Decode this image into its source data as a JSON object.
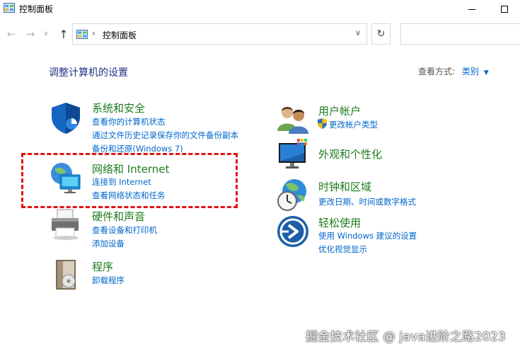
{
  "window": {
    "title": "控制面板"
  },
  "address": {
    "path": "控制面板"
  },
  "header": {
    "heading": "调整计算机的设置",
    "view_by_label": "查看方式:",
    "view_by_value": "类别"
  },
  "categories": [
    {
      "title": "系统和安全",
      "icon": "shield-icon",
      "links": [
        "查看你的计算机状态",
        "通过文件历史记录保存你的文件备份副本",
        "备份和还原(Windows 7)"
      ]
    },
    {
      "title": "网络和 Internet",
      "icon": "network-globe-icon",
      "links": [
        "连接到 Internet",
        "查看网络状态和任务"
      ]
    },
    {
      "title": "硬件和声音",
      "icon": "printer-icon",
      "links": [
        "查看设备和打印机",
        "添加设备"
      ]
    },
    {
      "title": "程序",
      "icon": "programs-disk-icon",
      "links": [
        "卸载程序"
      ]
    },
    {
      "title": "用户帐户",
      "icon": "users-icon",
      "links": [
        "更改帐户类型"
      ]
    },
    {
      "title": "外观和个性化",
      "icon": "monitor-palette-icon",
      "links": []
    },
    {
      "title": "时钟和区域",
      "icon": "globe-clock-icon",
      "links": [
        "更改日期、时间或数字格式"
      ]
    },
    {
      "title": "轻松使用",
      "icon": "accessibility-icon",
      "links": [
        "使用 Windows 建议的设置",
        "优化视觉显示"
      ]
    }
  ],
  "watermark": "掘金技术社区 @ java进阶之路2023",
  "colors": {
    "category_title": "#1d7b1d",
    "link": "#0066cc",
    "heading": "#1e3287",
    "highlight": "#e31212"
  }
}
